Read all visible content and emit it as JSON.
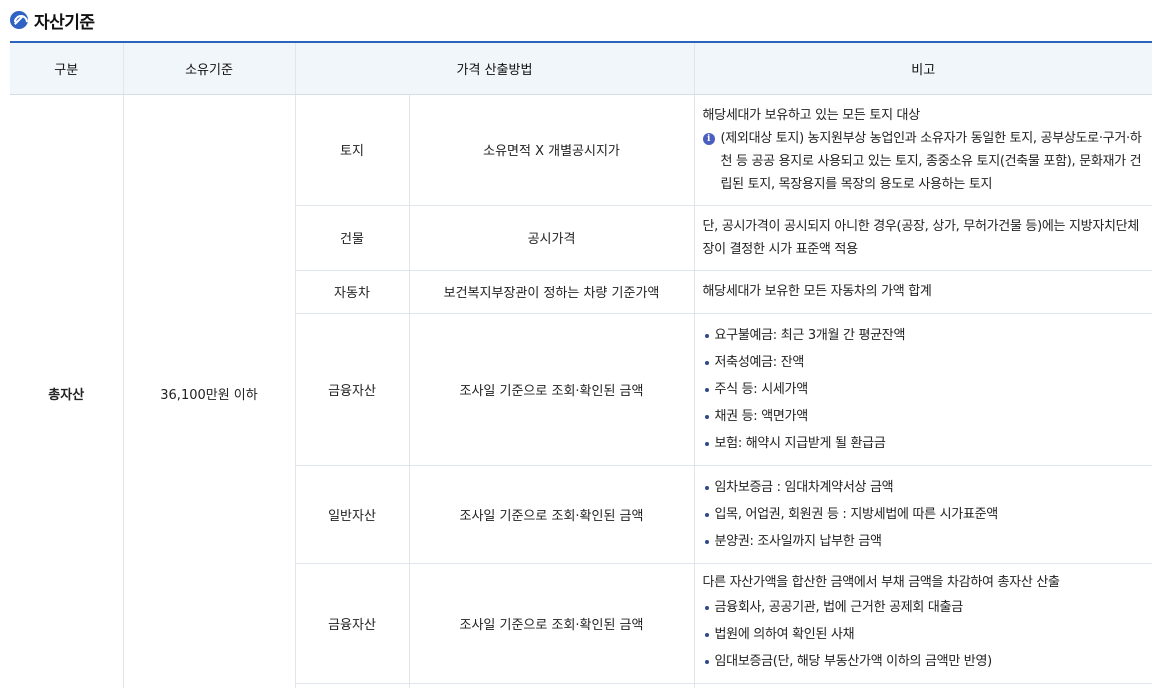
{
  "heading": {
    "title": "자산기준",
    "icon": "refresh-icon"
  },
  "table": {
    "headers": [
      "구분",
      "소유기준",
      "가격 산출방법",
      "비고"
    ],
    "category": "총자산",
    "ownership": "36,100만원 이하",
    "rows": [
      {
        "type": "토지",
        "method": "소유면적 X 개별공시지가",
        "note_text": "해당세대가 보유하고 있는 모든 토지 대상",
        "note_info": "(제외대상 토지) 농지원부상 농업인과 소유자가 동일한 토지, 공부상도로·구거·하천 등 공공 용지로 사용되고 있는 토지, 종중소유 토지(건축물 포함), 문화재가 건립된 토지, 목장용지를 목장의 용도로 사용하는 토지"
      },
      {
        "type": "건물",
        "method": "공시가격",
        "note_text": "단, 공시가격이 공시되지 아니한 경우(공장, 상가, 무허가건물 등)에는 지방자치단체장이 결정한 시가 표준액 적용"
      },
      {
        "type": "자동차",
        "method": "보건복지부장관이 정하는 차량 기준가액",
        "note_text": "해당세대가 보유한 모든 자동차의 가액 합계"
      },
      {
        "type": "금융자산",
        "method": "조사일 기준으로 조회·확인된 금액",
        "note_items": [
          "요구불예금: 최근 3개월 간 평균잔액",
          "저축성예금: 잔액",
          "주식 등: 시세가액",
          "채권 등: 액면가액",
          "보험: 해약시 지급받게 될 환급금"
        ]
      },
      {
        "type": "일반자산",
        "method": "조사일 기준으로 조회·확인된 금액",
        "note_items": [
          "임차보증금 : 임대차계약서상 금액",
          "입목, 어업권, 회원권 등 : 지방세법에 따른 시가표준액",
          "분양권: 조사일까지 납부한 금액"
        ]
      },
      {
        "type": "금융자산",
        "method": "조사일 기준으로 조회·확인된 금액",
        "note_text": "다른 자산가액을 합산한 금액에서 부채 금액을 차감하여 총자산 산출",
        "note_items": [
          "금융회사, 공공기관, 법에 근거한 공제회 대출금",
          "법원에 의하여 확인된 사채",
          "임대보증금(단, 해당 부동산가액 이하의 금액만 반영)"
        ]
      }
    ]
  }
}
